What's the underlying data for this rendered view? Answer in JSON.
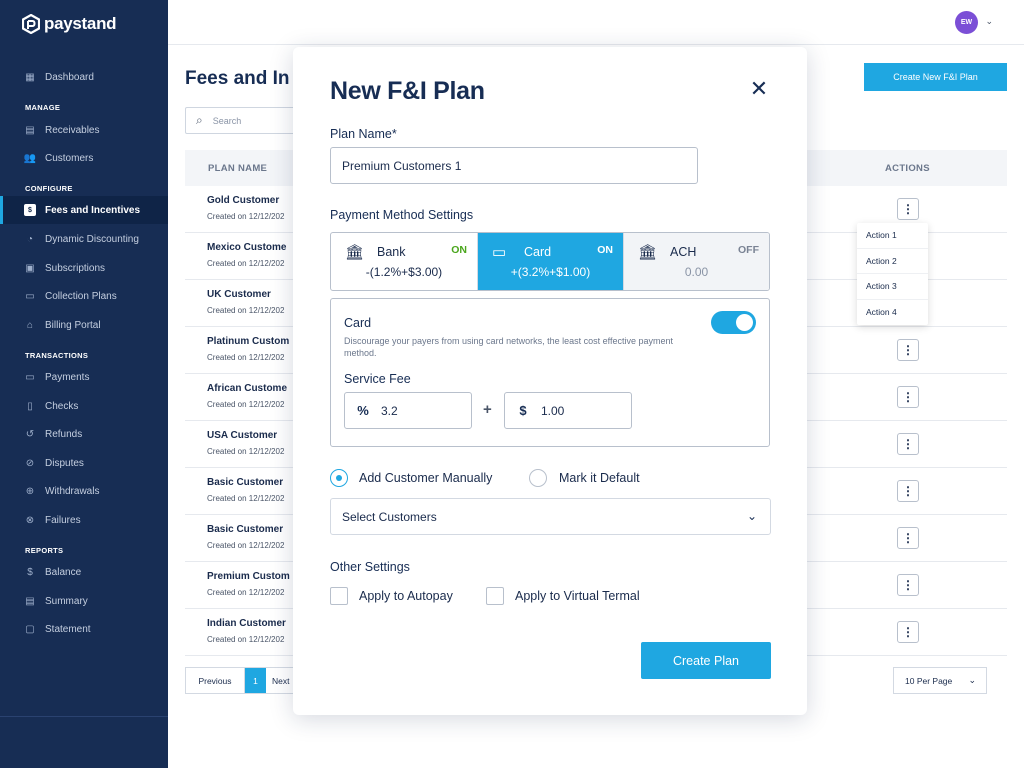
{
  "brand": {
    "name": "paystand"
  },
  "sidebar": {
    "dashboard": "Dashboard",
    "sections": {
      "manage": "MANAGE",
      "configure": "CONFIGURE",
      "transactions": "TRANSACTIONS",
      "reports": "REPORTS"
    },
    "items": [
      {
        "label": "Receivables"
      },
      {
        "label": "Customers"
      },
      {
        "label": "Fees and Incentives"
      },
      {
        "label": "Dynamic Discounting"
      },
      {
        "label": "Subscriptions"
      },
      {
        "label": "Collection Plans"
      },
      {
        "label": "Billing Portal"
      },
      {
        "label": "Payments"
      },
      {
        "label": "Checks"
      },
      {
        "label": "Refunds"
      },
      {
        "label": "Disputes"
      },
      {
        "label": "Withdrawals"
      },
      {
        "label": "Failures"
      },
      {
        "label": "Balance"
      },
      {
        "label": "Summary"
      },
      {
        "label": "Statement"
      }
    ]
  },
  "topbar": {
    "avatar_initials": "EW"
  },
  "page": {
    "title": "Fees and In",
    "create_button": "Create New F&I Plan",
    "search_placeholder": "Search",
    "table": {
      "col_name": "PLAN NAME",
      "col_actions": "ACTIONS",
      "rows": [
        {
          "name": "Gold Customer",
          "date": "Created on 12/12/202"
        },
        {
          "name": "Mexico Custome",
          "date": "Created on 12/12/202"
        },
        {
          "name": "UK Customer",
          "date": "Created on 12/12/202"
        },
        {
          "name": "Platinum Custom",
          "date": "Created on 12/12/202"
        },
        {
          "name": "African Custome",
          "date": "Created on 12/12/202"
        },
        {
          "name": "USA Customer",
          "date": "Created on 12/12/202"
        },
        {
          "name": "Basic Customer",
          "date": "Created on 12/12/202"
        },
        {
          "name": "Basic Customer",
          "date": "Created on 12/12/202"
        },
        {
          "name": "Premium Custom",
          "date": "Created on 12/12/202"
        },
        {
          "name": "Indian Customer",
          "date": "Created on 12/12/202"
        }
      ]
    },
    "actions_menu": [
      "Action 1",
      "Action 2",
      "Action 3",
      "Action 4"
    ],
    "pager": {
      "prev": "Previous",
      "current": "1",
      "next": "Next"
    },
    "per_page": "10 Per Page"
  },
  "modal": {
    "title": "New F&I Plan",
    "plan_name_label": "Plan Name*",
    "plan_name_value": "Premium Customers 1",
    "payment_settings_label": "Payment Method Settings",
    "methods": [
      {
        "name": "Bank",
        "status": "ON",
        "fee": "-(1.2%+$3.00)"
      },
      {
        "name": "Card",
        "status": "ON",
        "fee": "+(3.2%+$1.00)"
      },
      {
        "name": "ACH",
        "status": "OFF",
        "fee": "0.00"
      }
    ],
    "card_section": {
      "title": "Card",
      "description": "Discourage your payers from using card networks, the least cost effective payment method.",
      "service_fee_label": "Service Fee",
      "percent_value": "3.2",
      "dollar_value": "1.00",
      "plus": "+"
    },
    "radio_manual": "Add Customer Manually",
    "radio_default": "Mark it Default",
    "select_placeholder": "Select Customers",
    "other_settings_label": "Other Settings",
    "check_autopay": "Apply to Autopay",
    "check_virtual": "Apply to Virtual Termal",
    "create_button": "Create Plan"
  }
}
